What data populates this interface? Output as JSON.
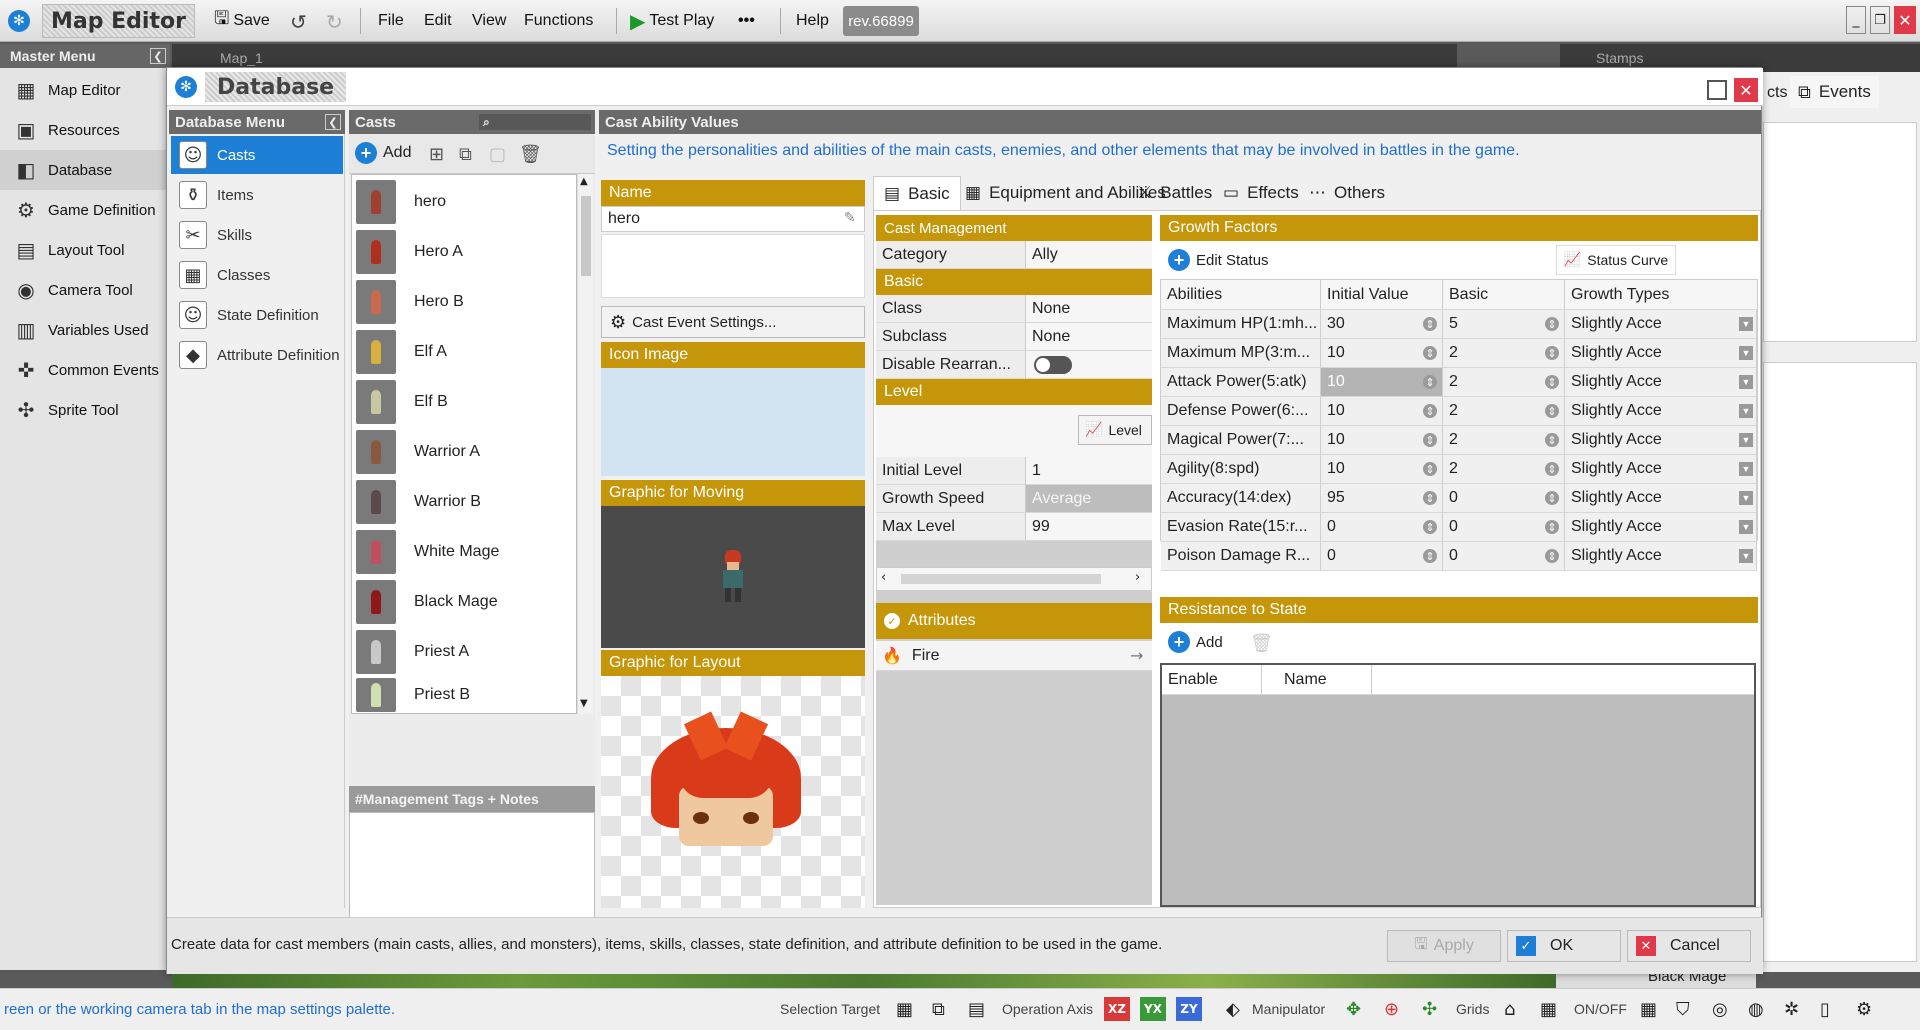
{
  "topbar": {
    "app_title": "Map Editor",
    "save": "Save",
    "menus": [
      "File",
      "Edit",
      "View",
      "Functions"
    ],
    "test_play": "Test Play",
    "more": "•••",
    "help": "Help",
    "revision": "rev.66899"
  },
  "master_menu": {
    "title": "Master Menu",
    "items": [
      {
        "label": "Map Editor",
        "icon": "map-icon"
      },
      {
        "label": "Resources",
        "icon": "resources-icon"
      },
      {
        "label": "Database",
        "icon": "database-icon"
      },
      {
        "label": "Game Definition",
        "icon": "gamepad-icon"
      },
      {
        "label": "Layout Tool",
        "icon": "layout-icon"
      },
      {
        "label": "Camera Tool",
        "icon": "camera-icon"
      },
      {
        "label": "Variables Used",
        "icon": "variables-icon"
      },
      {
        "label": "Common Events",
        "icon": "events-icon"
      },
      {
        "label": "Sprite Tool",
        "icon": "sprite-icon"
      }
    ]
  },
  "background": {
    "map_tab": "Map_1",
    "stamps": "Stamps",
    "events_tab": "Events",
    "right_tab_partial": "cts",
    "bottom_partial": "Black Mage"
  },
  "dialog": {
    "title": "Database",
    "db_menu_title": "Database Menu",
    "db_items": [
      "Casts",
      "Items",
      "Skills",
      "Classes",
      "State Definition",
      "Attribute Definition"
    ],
    "casts_title": "Casts",
    "add": "Add",
    "casts": [
      "hero",
      "Hero A",
      "Hero B",
      "Elf A",
      "Elf B",
      "Warrior A",
      "Warrior B",
      "White Mage",
      "Black Mage",
      "Priest A",
      "Priest B"
    ],
    "tags_title": "#Management Tags + Notes",
    "cav_title": "Cast Ability Values",
    "description": "Setting the personalities and abilities of the main casts, enemies, and other elements that may be involved in battles in the game.",
    "name_label": "Name",
    "name_value": "hero",
    "cast_event_settings": "Cast Event Settings...",
    "icon_image": "Icon Image",
    "graphic_moving": "Graphic for Moving",
    "graphic_layout": "Graphic for Layout",
    "tabs": [
      "Basic",
      "Equipment and Abilities",
      "Battles",
      "Effects",
      "Others"
    ],
    "cast_management": "Cast Management",
    "category_label": "Category",
    "category_value": "Ally",
    "basic_header": "Basic",
    "class_label": "Class",
    "class_value": "None",
    "subclass_label": "Subclass",
    "subclass_value": "None",
    "disable_label": "Disable Rearran...",
    "level_header": "Level",
    "level_btn": "Level",
    "initial_level_label": "Initial Level",
    "initial_level_value": "1",
    "growth_speed_label": "Growth Speed",
    "growth_speed_value": "Average",
    "max_level_label": "Max Level",
    "max_level_value": "99",
    "attributes_header": "Attributes",
    "attribute_fire": "Fire",
    "growth_factors": "Growth Factors",
    "edit_status": "Edit Status",
    "status_curve": "Status Curve",
    "growth_headers": [
      "Abilities",
      "Initial Value",
      "Basic",
      "Growth Types"
    ],
    "growth_rows": [
      {
        "ability": "Maximum HP(1:mh...",
        "initial": "30",
        "basic": "5",
        "type": "Slightly Acce"
      },
      {
        "ability": "Maximum MP(3:m...",
        "initial": "10",
        "basic": "2",
        "type": "Slightly Acce"
      },
      {
        "ability": "Attack Power(5:atk)",
        "initial": "10",
        "basic": "2",
        "type": "Slightly Acce"
      },
      {
        "ability": "Defense Power(6:...",
        "initial": "10",
        "basic": "2",
        "type": "Slightly Acce"
      },
      {
        "ability": "Magical Power(7:...",
        "initial": "10",
        "basic": "2",
        "type": "Slightly Acce"
      },
      {
        "ability": "Agility(8:spd)",
        "initial": "10",
        "basic": "2",
        "type": "Slightly Acce"
      },
      {
        "ability": "Accuracy(14:dex)",
        "initial": "95",
        "basic": "0",
        "type": "Slightly Acce"
      },
      {
        "ability": "Evasion Rate(15:r...",
        "initial": "0",
        "basic": "0",
        "type": "Slightly Acce"
      },
      {
        "ability": "Poison Damage R...",
        "initial": "0",
        "basic": "0",
        "type": "Slightly Acce"
      }
    ],
    "resistance_header": "Resistance to State",
    "res_add": "Add",
    "res_headers": [
      "Enable",
      "Name"
    ],
    "footer_text": "Create data for cast members (main casts, allies, and monsters), items, skills, classes, state definition, and attribute definition to be used in the game.",
    "apply": "Apply",
    "ok": "OK",
    "cancel": "Cancel"
  },
  "statusbar": {
    "hint": "reen or the working camera tab in the map settings palette.",
    "selection_target": "Selection Target",
    "operation_axis": "Operation Axis",
    "axes": [
      "XZ",
      "YX",
      "ZY"
    ],
    "manipulator": "Manipulator",
    "grids": "Grids",
    "onoff": "ON/OFF"
  },
  "colors": {
    "accent": "#1e7fd7",
    "section_gold": "#c5960a",
    "close_red": "#e0394a"
  }
}
